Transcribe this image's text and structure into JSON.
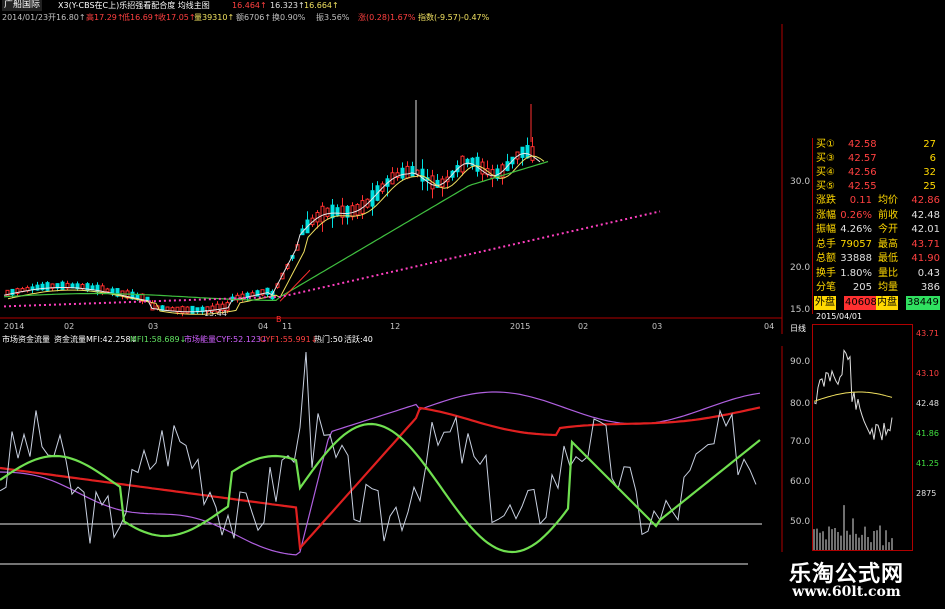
{
  "header": {
    "stock_name": "广船国际",
    "indicator_line": "X3(Y-CBS在C上)乐招强看配合度  均线主图",
    "ind_val1": "16.464↑",
    "ind_val2": "16.323↑",
    "ind_val3": "16.664↑"
  },
  "quote": {
    "date": "2014/01/23",
    "open": "开16.80↑",
    "high": "高17.29↑",
    "low": "低16.69↑",
    "close": "收17.05↑",
    "volume": "量39310↑",
    "amount": "额6706↑",
    "turnover": "换0.90%",
    "amplitude": "振3.56%",
    "change": "涨(0.28)1.67%",
    "index": "指数(-9.57)-0.47%"
  },
  "main_chart": {
    "y_ticks": [
      "30.00",
      "20.00",
      "15.00"
    ],
    "x_ticks": [
      "2014",
      "02",
      "03",
      "04",
      "11",
      "12",
      "2015",
      "02",
      "03",
      "04"
    ],
    "low_marker": "15.44",
    "signal_label": "B",
    "colors": {
      "up": "#ff3030",
      "down": "#00e0e0",
      "ma_white": "#e8e8e8",
      "ma_yellow": "#f0e060",
      "ma_green": "#40c040",
      "dotted": "#ff40c0"
    }
  },
  "sub_chart": {
    "label_main": "市场资金流量",
    "label_fund": "资金流量MFI:42.258↓",
    "label_mfi1": "MFI1:58.689↓",
    "label_market": "市场能量CYF:52.123↓",
    "label_cyf1": "CYF1:55.991↓",
    "label_hot": "热门:50",
    "label_active": "活跃:40",
    "y_ticks": [
      "90.00",
      "80.00",
      "70.00",
      "60.00",
      "50.00"
    ]
  },
  "quote_panel": {
    "bids": [
      {
        "label": "买①",
        "price": "42.58",
        "vol": "27"
      },
      {
        "label": "买③",
        "price": "42.57",
        "vol": "6"
      },
      {
        "label": "买④",
        "price": "42.56",
        "vol": "32"
      },
      {
        "label": "买⑤",
        "price": "42.55",
        "vol": "25"
      }
    ],
    "stats": [
      {
        "k1": "涨跌",
        "v1": "0.11",
        "k2": "均价",
        "v2": "42.86"
      },
      {
        "k1": "涨幅",
        "v1": "0.26%",
        "k2": "前收",
        "v2": "42.48"
      },
      {
        "k1": "振幅",
        "v1": "4.26%",
        "k2": "今开",
        "v2": "42.01"
      },
      {
        "k1": "总手",
        "v1": "79057",
        "k2": "最高",
        "v2": "43.71"
      },
      {
        "k1": "总额",
        "v1": "33888",
        "k2": "最低",
        "v2": "41.90"
      },
      {
        "k1": "换手",
        "v1": "1.80%",
        "k2": "量比",
        "v2": "0.43"
      },
      {
        "k1": "分笔",
        "v1": "205",
        "k2": "均量",
        "v2": "386"
      }
    ],
    "outer_label": "外盘",
    "outer_val": "40608",
    "inner_label": "内盘",
    "inner_val": "38449",
    "date": "2015/04/01",
    "tab_label": "日线"
  },
  "mini_chart": {
    "y_ticks": [
      "43.71",
      "43.10",
      "42.48",
      "41.86",
      "41.25"
    ],
    "vol_tick": "2875"
  },
  "watermark": {
    "title": "乐淘公式网",
    "url": "www.60lt.com"
  }
}
